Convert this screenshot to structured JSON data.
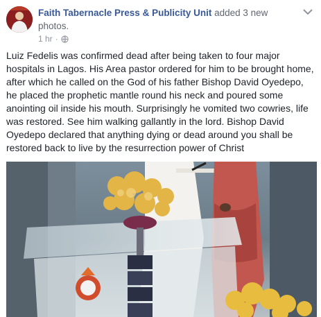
{
  "post": {
    "page_name": "Faith Tabernacle Press & Publicity Unit",
    "action_text": " added 3 new photos.",
    "time": "1 hr",
    "separator": "·",
    "privacy_icon": "globe-icon",
    "more_icon": "chevron-down-icon",
    "body": "Luiz Fedelis was confirmed dead after being taken to four major hospitals in Lagos. His Area pastor ordered for him to be brought home, after which he called on the God of his father Bishop David Oyedepo, he placed the prophetic mantle round his neck and poured some anointing oil inside his mouth. Surprisingly he vomited two cowries, life was restored. See him walking gallantly in the lord. Bishop David Oyedepo declared that anything dying or dead around you shall be restored back to live by the resurrection power of Christ"
  },
  "colors": {
    "link": "#385898",
    "meta": "#90949c",
    "text": "#1d2129"
  }
}
